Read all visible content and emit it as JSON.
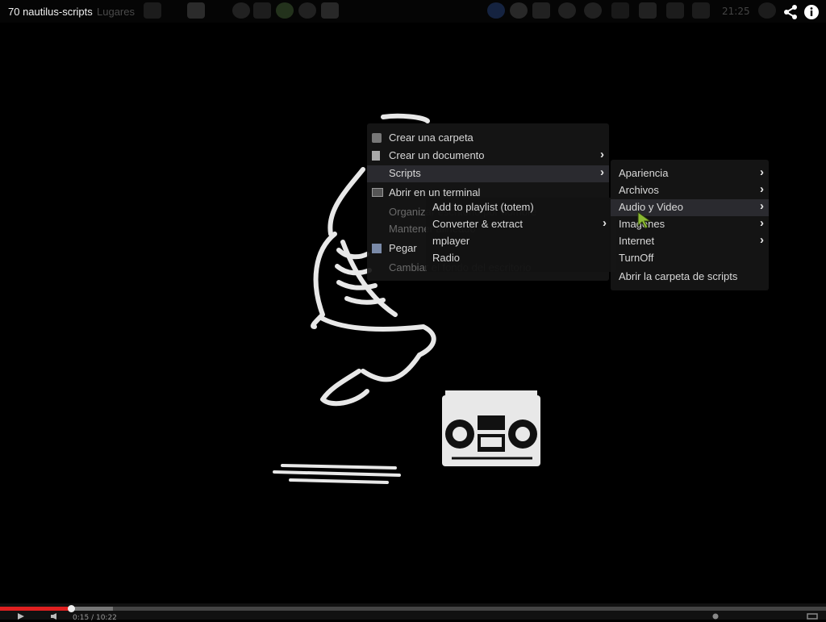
{
  "video": {
    "title": "70 nautilus-scripts",
    "time": "0:15 / 10:22"
  },
  "panel": {
    "places_label": "Lugares",
    "clock": "21:25"
  },
  "context_menu": {
    "items": [
      {
        "label": "Crear una carpeta",
        "icon": "folder-icon",
        "submenu": false
      },
      {
        "label": "Crear un documento",
        "icon": "document-icon",
        "submenu": true
      },
      {
        "label": "Scripts",
        "icon": "",
        "submenu": true,
        "highlighted": true
      },
      {
        "label": "Abrir en un terminal",
        "icon": "terminal-icon",
        "submenu": false
      },
      {
        "label": "Organizar escritorio por nombre",
        "icon": "",
        "submenu": false
      },
      {
        "label": "Mantener alineado",
        "icon": "",
        "submenu": false
      },
      {
        "label": "Pegar",
        "icon": "paste-icon",
        "submenu": false
      },
      {
        "label": "Cambiar el fondo del escritorio",
        "icon": "",
        "submenu": false
      }
    ]
  },
  "scripts_menu": {
    "items": [
      {
        "label": "Apariencia",
        "submenu": true
      },
      {
        "label": "Archivos",
        "submenu": true
      },
      {
        "label": "Audio y Video",
        "submenu": true,
        "highlighted": true
      },
      {
        "label": "Imagenes",
        "submenu": true
      },
      {
        "label": "Internet",
        "submenu": true
      },
      {
        "label": "TurnOff",
        "submenu": false
      },
      {
        "label": "Abrir la carpeta de scripts",
        "submenu": false
      }
    ]
  },
  "audio_video_menu": {
    "items": [
      {
        "label": "Add to playlist (totem)",
        "submenu": false
      },
      {
        "label": "Converter & extract",
        "submenu": true
      },
      {
        "label": "mplayer",
        "submenu": false
      },
      {
        "label": "Radio",
        "submenu": false
      }
    ]
  },
  "player": {
    "progress": 0.086,
    "buffered": 0.137
  },
  "colors": {
    "progress": "#e02020",
    "background": "#000000",
    "menu_bg": "#161616"
  }
}
